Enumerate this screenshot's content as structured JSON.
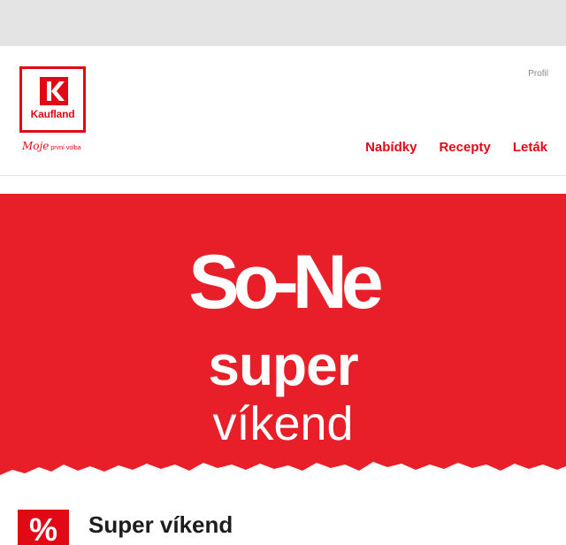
{
  "header": {
    "logo_text": "Kaufland",
    "tagline": "Moje",
    "tagline_small": "první volba",
    "profile_link": "Profil",
    "nav": [
      {
        "label": "Nabídky"
      },
      {
        "label": "Recepty"
      },
      {
        "label": "Leták"
      }
    ]
  },
  "hero": {
    "line1": "So-Ne",
    "line2": "super",
    "line3": "víkend",
    "background": "#e81f28"
  },
  "promo": {
    "icon": "%",
    "title": "Super víkend"
  },
  "colors": {
    "brand": "#e10915"
  }
}
